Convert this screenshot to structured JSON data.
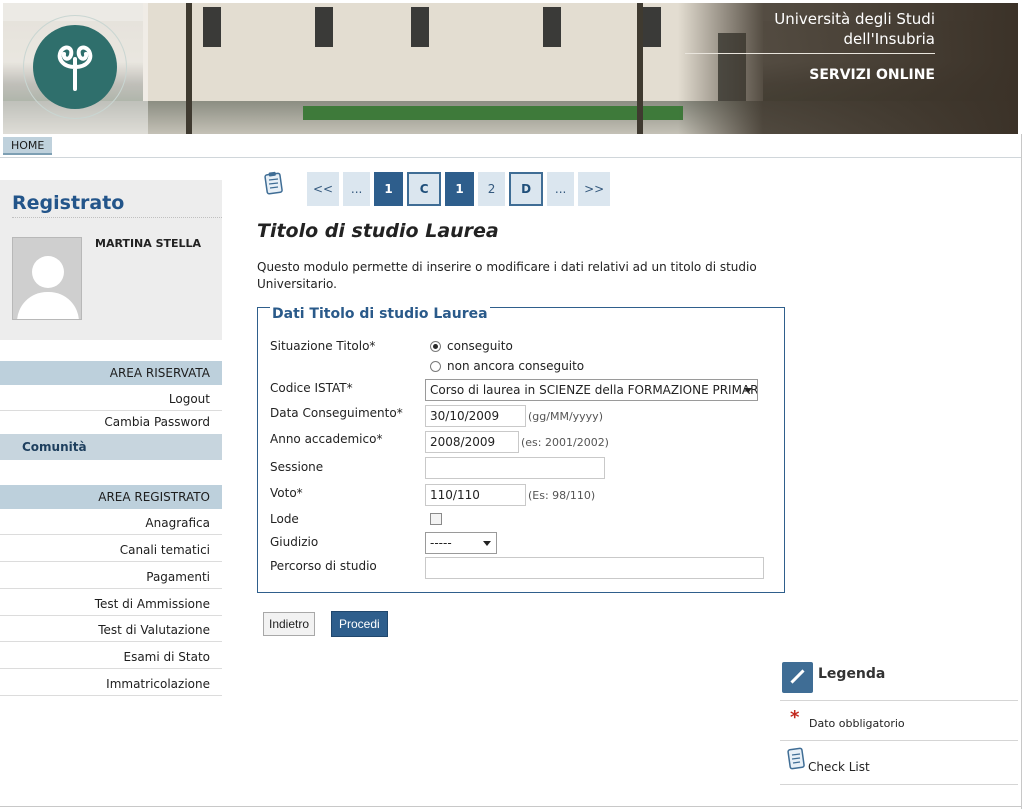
{
  "header": {
    "university_line1": "Università degli Studi",
    "university_line2": "dell'Insubria",
    "services": "SERVIZI ONLINE"
  },
  "topnav": {
    "home": "HOME"
  },
  "sidebar": {
    "title": "Registrato",
    "user_name": "MARTINA STELLA",
    "area_riservata": {
      "heading": "AREA RISERVATA",
      "items": [
        "Logout",
        "Cambia Password"
      ],
      "active": "Comunità"
    },
    "area_registrato": {
      "heading": "AREA REGISTRATO",
      "items": [
        "Anagrafica",
        "Canali tematici",
        "Pagamenti",
        "Test di Ammissione",
        "Test di Valutazione",
        "Esami di Stato",
        "Immatricolazione"
      ]
    }
  },
  "pager": {
    "items": [
      "<<",
      "...",
      "1",
      "C",
      "1",
      "2",
      "D",
      "...",
      ">>"
    ]
  },
  "main": {
    "title": "Titolo di studio Laurea",
    "intro": "Questo modulo permette di inserire o modificare i dati relativi ad un titolo di studio Universitario."
  },
  "form": {
    "legend": "Dati Titolo di studio Laurea",
    "situazione": {
      "label": "Situazione Titolo*",
      "option1": "conseguito",
      "option2": "non ancora conseguito",
      "selected": "conseguito"
    },
    "istat": {
      "label": "Codice ISTAT*",
      "value": "Corso di laurea in SCIENZE della FORMAZIONE PRIMARIA"
    },
    "data": {
      "label": "Data Conseguimento*",
      "value": "30/10/2009",
      "hint": "(gg/MM/yyyy)"
    },
    "anno": {
      "label": "Anno accademico*",
      "value": "2008/2009",
      "hint": "(es: 2001/2002)"
    },
    "sessione": {
      "label": "Sessione",
      "value": ""
    },
    "voto": {
      "label": "Voto*",
      "value": "110/110",
      "hint": "(Es: 98/110)"
    },
    "lode": {
      "label": "Lode",
      "checked": false
    },
    "giudizio": {
      "label": "Giudizio",
      "value": "-----"
    },
    "percorso": {
      "label": "Percorso di studio",
      "value": ""
    }
  },
  "buttons": {
    "back": "Indietro",
    "next": "Procedi"
  },
  "legend_panel": {
    "title": "Legenda",
    "required": "Dato obbligatorio",
    "checklist": "Check List"
  },
  "colors": {
    "accent": "#2e5e8c",
    "sidebar_section": "#bdd0dc",
    "title_blue": "#23558a",
    "required_star": "#c2281e"
  }
}
